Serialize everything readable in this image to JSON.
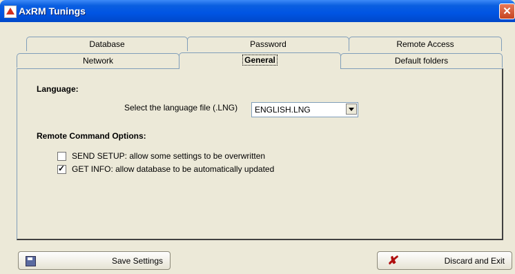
{
  "window": {
    "title": "AxRM Tunings",
    "close_glyph": "✕"
  },
  "tabs": {
    "row1": [
      {
        "label": "Database"
      },
      {
        "label": "Password"
      },
      {
        "label": "Remote Access"
      }
    ],
    "row2": [
      {
        "label": "Network"
      },
      {
        "label": "General"
      },
      {
        "label": "Default folders"
      }
    ],
    "active": "General"
  },
  "general": {
    "language_heading": "Language:",
    "language_label": "Select the language file (.LNG)",
    "language_value": "ENGLISH.LNG",
    "remote_heading": "Remote Command Options:",
    "options": [
      {
        "label": "SEND SETUP: allow some settings to be overwritten",
        "checked": false
      },
      {
        "label": "GET INFO: allow database to be automatically updated",
        "checked": true
      }
    ]
  },
  "buttons": {
    "save": "Save Settings",
    "discard": "Discard and Exit"
  },
  "colors": {
    "titlebar": "#0054e3",
    "face": "#ece9d8",
    "close": "#c64520"
  }
}
